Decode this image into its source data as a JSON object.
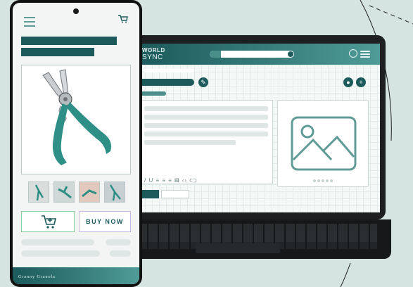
{
  "phone": {
    "buy_now_label": "BUY NOW",
    "footer_brand": "Granny Granola",
    "cart_icon": "cart-icon",
    "menu_icon": "hamburger-icon"
  },
  "laptop": {
    "brand_line1": "WORLD",
    "brand_line2": "SYNC",
    "toolbar_glyphs": "𝐼 U ≡ ≡ ≡ ▤ ‹› ⊂⊃",
    "edit_icon": "✎",
    "plus_icon": "+"
  },
  "colors": {
    "primary": "#1c5a5c",
    "accent": "#4f9b97",
    "background": "#d5e3e1"
  }
}
